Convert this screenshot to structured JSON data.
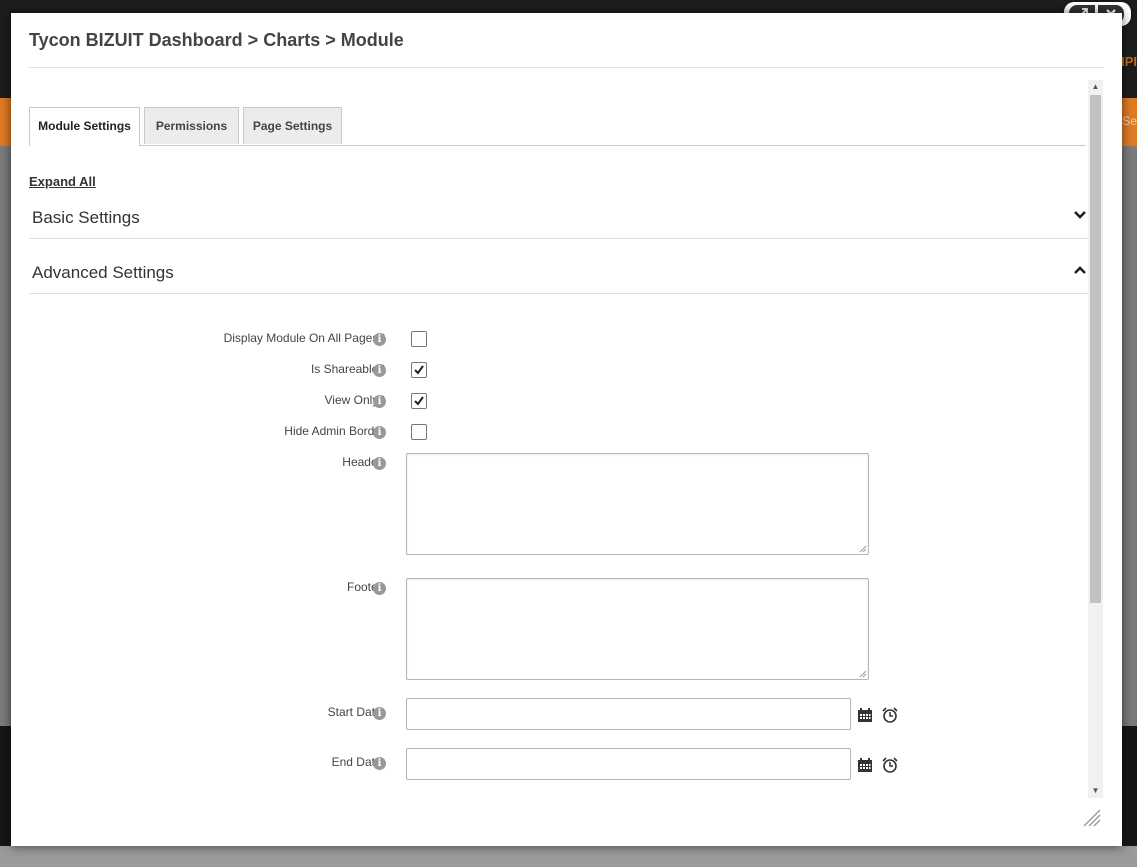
{
  "background": {
    "top_right_text": "IPI",
    "nav_text": "Se"
  },
  "dialog": {
    "title": "Tycon BIZUIT Dashboard > Charts > Module",
    "controls": {
      "expand_icon": "expand-icon",
      "close_icon": "close-icon"
    }
  },
  "tabs": [
    {
      "label": "Module Settings",
      "active": true
    },
    {
      "label": "Permissions",
      "active": false
    },
    {
      "label": "Page Settings",
      "active": false
    }
  ],
  "expand_all": "Expand All",
  "sections": {
    "basic": {
      "label": "Basic Settings",
      "expanded": false
    },
    "advanced": {
      "label": "Advanced Settings",
      "expanded": true
    }
  },
  "fields": {
    "display_all_pages": {
      "label": "Display Module On All Pages?",
      "checked": false
    },
    "is_shareable": {
      "label": "Is Shareable?",
      "checked": true
    },
    "view_only": {
      "label": "View Only?",
      "checked": true
    },
    "hide_admin_border": {
      "label": "Hide Admin Border",
      "checked": false
    },
    "header": {
      "label": "Header:",
      "value": ""
    },
    "footer": {
      "label": "Footer:",
      "value": ""
    },
    "start_date": {
      "label": "Start Date:",
      "value": ""
    },
    "end_date": {
      "label": "End Date:",
      "value": ""
    }
  },
  "colors": {
    "accent_orange": "#e07b24",
    "title_text": "#444444"
  }
}
